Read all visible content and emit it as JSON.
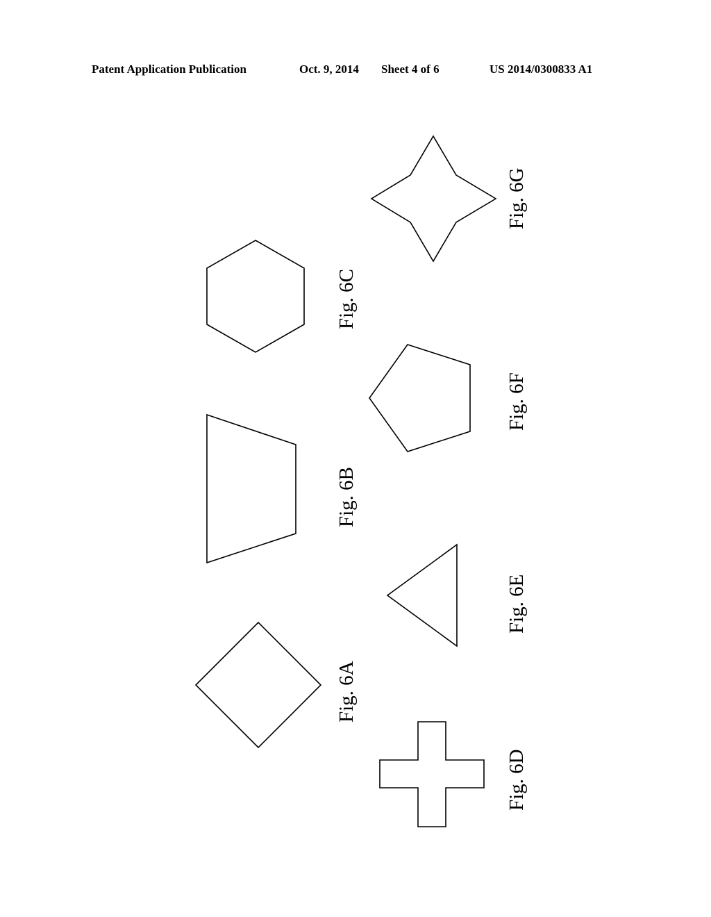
{
  "header": {
    "publication": "Patent Application Publication",
    "date": "Oct. 9, 2014",
    "sheet": "Sheet 4 of 6",
    "number": "US 2014/0300833 A1"
  },
  "figures": [
    {
      "id": "6A",
      "label": "Fig. 6A",
      "shape": "diamond"
    },
    {
      "id": "6B",
      "label": "Fig. 6B",
      "shape": "trapezoid"
    },
    {
      "id": "6C",
      "label": "Fig. 6C",
      "shape": "hexagon"
    },
    {
      "id": "6D",
      "label": "Fig. 6D",
      "shape": "cross"
    },
    {
      "id": "6E",
      "label": "Fig. 6E",
      "shape": "triangle"
    },
    {
      "id": "6F",
      "label": "Fig. 6F",
      "shape": "pentagon"
    },
    {
      "id": "6G",
      "label": "Fig. 6G",
      "shape": "four-pointed-star"
    }
  ]
}
